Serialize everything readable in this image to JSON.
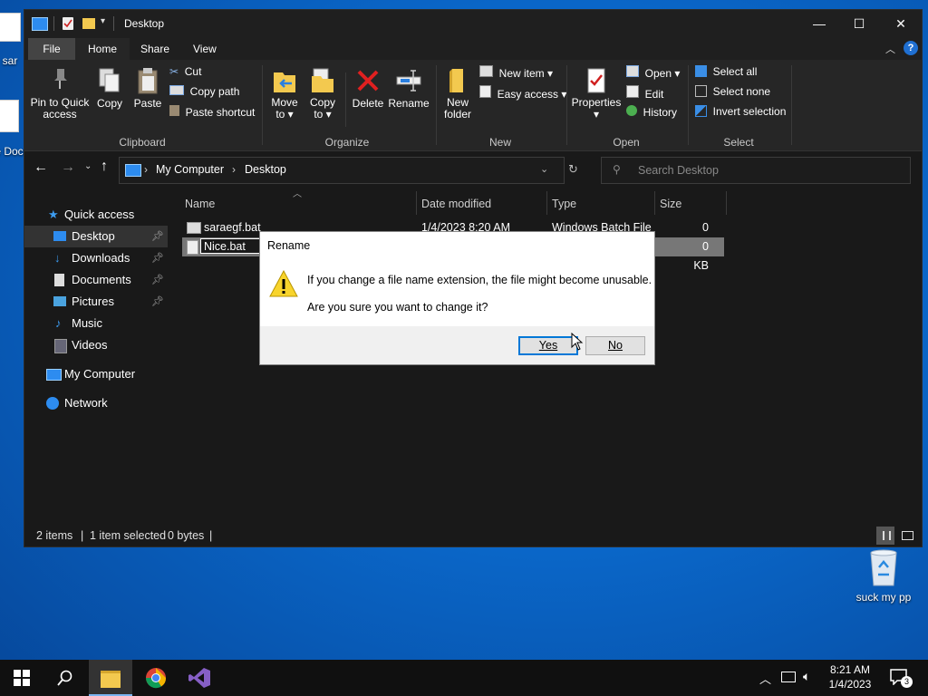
{
  "desktop": {
    "icons": [
      {
        "label": "sar",
        "icon": "file-icon"
      },
      {
        "label": "Ne Docu",
        "icon": "document-icon"
      },
      {
        "label": "suck my pp",
        "icon": "recycle-bin-icon"
      }
    ]
  },
  "window": {
    "title": "Desktop",
    "quick_toolbar": [
      "properties-icon",
      "new-folder-icon",
      "dropdown-icon"
    ]
  },
  "ribbon": {
    "tabs": [
      {
        "label": "File",
        "active": false,
        "accent": "#2f6bba"
      },
      {
        "label": "Home",
        "active": true
      },
      {
        "label": "Share",
        "active": false
      },
      {
        "label": "View",
        "active": false
      }
    ],
    "clipboard": {
      "label": "Clipboard",
      "pin": "Pin to Quick access",
      "pin_line1": "Pin to Quick",
      "pin_line2": "access",
      "copy": "Copy",
      "paste": "Paste",
      "cut": "Cut",
      "copy_path": "Copy path",
      "paste_shortcut": "Paste shortcut"
    },
    "organize": {
      "label": "Organize",
      "move_to": "Move to",
      "move_line1": "Move",
      "move_line2": "to",
      "copy_to": "Copy to",
      "copy_line1": "Copy",
      "copy_line2": "to",
      "delete": "Delete",
      "rename": "Rename"
    },
    "new": {
      "label": "New",
      "new_folder_line1": "New",
      "new_folder_line2": "folder",
      "new_item": "New item",
      "easy_access": "Easy access"
    },
    "open": {
      "label": "Open",
      "properties": "Properties",
      "open": "Open",
      "edit": "Edit",
      "history": "History"
    },
    "select": {
      "label": "Select",
      "select_all": "Select all",
      "select_none": "Select none",
      "invert": "Invert selection"
    }
  },
  "navbar": {
    "breadcrumb": [
      "My Computer",
      "Desktop"
    ],
    "search_placeholder": "Search Desktop"
  },
  "navpane": {
    "items": [
      {
        "label": "Quick access",
        "icon": "star-icon",
        "pinned": false
      },
      {
        "label": "Desktop",
        "icon": "desktop-icon",
        "pinned": true,
        "selected": true
      },
      {
        "label": "Downloads",
        "icon": "download-icon",
        "pinned": true
      },
      {
        "label": "Documents",
        "icon": "documents-icon",
        "pinned": true
      },
      {
        "label": "Pictures",
        "icon": "pictures-icon",
        "pinned": true
      },
      {
        "label": "Music",
        "icon": "music-icon",
        "pinned": false
      },
      {
        "label": "Videos",
        "icon": "videos-icon",
        "pinned": false
      },
      {
        "label": "My Computer",
        "icon": "computer-icon",
        "pinned": false
      },
      {
        "label": "Network",
        "icon": "network-icon",
        "pinned": false
      }
    ]
  },
  "filelist": {
    "columns": [
      "Name",
      "Date modified",
      "Type",
      "Size"
    ],
    "rows": [
      {
        "name": "saraegf.bat",
        "date": "1/4/2023 8:20 AM",
        "type": "Windows Batch File",
        "size": "0 KB"
      },
      {
        "name": "Nice.bat",
        "date": "",
        "type": "",
        "size": "0 KB",
        "editing": true
      }
    ]
  },
  "statusbar": {
    "items": "2 items",
    "selected": "1 item selected",
    "bytes": "0 bytes"
  },
  "dialog": {
    "title": "Rename",
    "message": "If you change a file name extension, the file might become unusable.",
    "question": "Are you sure you want to change it?",
    "yes": "Yes",
    "no": "No"
  },
  "taskbar": {
    "apps": [
      "start-icon",
      "search-icon",
      "file-explorer-icon",
      "chrome-icon",
      "visual-studio-icon"
    ],
    "time": "8:21 AM",
    "date": "1/4/2023",
    "notification_count": "3"
  }
}
